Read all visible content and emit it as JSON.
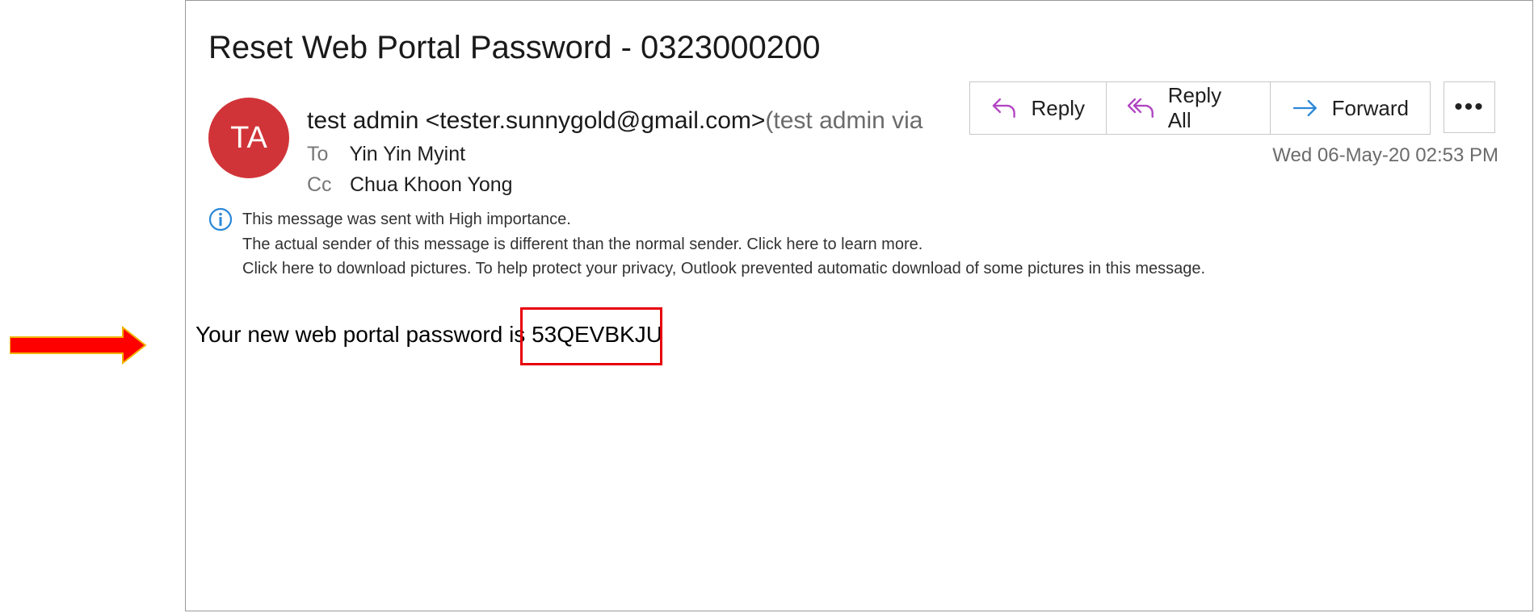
{
  "email": {
    "subject": "Reset Web Portal Password - 0323000200",
    "avatar_initials": "TA",
    "avatar_color": "#d13438",
    "sender_name_email": "test admin <tester.sunnygold@gmail.com>",
    "sender_via": "(test admin via",
    "to_label": "To",
    "to_value": "Yin Yin Myint",
    "cc_label": "Cc",
    "cc_value": "Chua Khoon Yong",
    "datetime": "Wed 06-May-20 02:53 PM",
    "info": {
      "icon": "info-icon",
      "importance": "This message was sent with High importance.",
      "sender_notice": "The actual sender of this message is different than the normal sender. Click here to learn more.",
      "pictures_notice": "Click here to download pictures. To help protect your privacy, Outlook prevented automatic download of some pictures in this message."
    },
    "body_prefix": "Your new web portal password is ",
    "password": "53QEVBKJU"
  },
  "actions": {
    "reply": "Reply",
    "reply_all": "Reply All",
    "forward": "Forward",
    "more": "•••",
    "reply_icon_color": "#b146c2",
    "forward_icon_color": "#2b88d8"
  },
  "annotation": {
    "arrow_color": "#ff0000",
    "highlight_color": "#e8000b"
  }
}
